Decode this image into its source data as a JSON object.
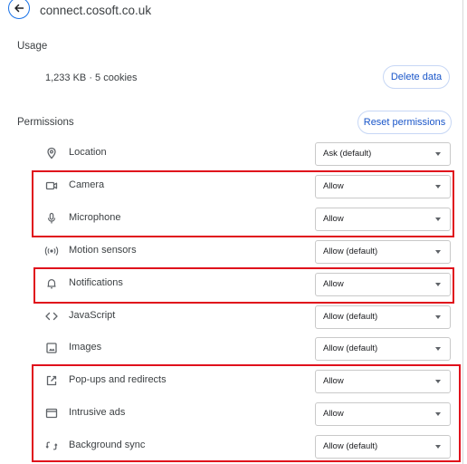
{
  "site": {
    "title": "connect.cosoft.co.uk"
  },
  "usage": {
    "heading": "Usage",
    "summary": "1,233 KB · 5 cookies",
    "delete_label": "Delete data"
  },
  "permissions": {
    "heading": "Permissions",
    "reset_label": "Reset permissions",
    "items": [
      {
        "label": "Location",
        "value": "Ask (default)",
        "icon": "location-pin-icon"
      },
      {
        "label": "Camera",
        "value": "Allow",
        "icon": "camera-icon"
      },
      {
        "label": "Microphone",
        "value": "Allow",
        "icon": "microphone-icon"
      },
      {
        "label": "Motion sensors",
        "value": "Allow (default)",
        "icon": "motion-sensors-icon"
      },
      {
        "label": "Notifications",
        "value": "Allow",
        "icon": "bell-icon"
      },
      {
        "label": "JavaScript",
        "value": "Allow (default)",
        "icon": "code-icon"
      },
      {
        "label": "Images",
        "value": "Allow (default)",
        "icon": "image-icon"
      },
      {
        "label": "Pop-ups and redirects",
        "value": "Allow",
        "icon": "open-in-new-icon"
      },
      {
        "label": "Intrusive ads",
        "value": "Allow",
        "icon": "ads-window-icon"
      },
      {
        "label": "Background sync",
        "value": "Allow (default)",
        "icon": "sync-icon"
      }
    ]
  },
  "highlight_color": "#e0101c",
  "accent_color": "#1a73e8"
}
